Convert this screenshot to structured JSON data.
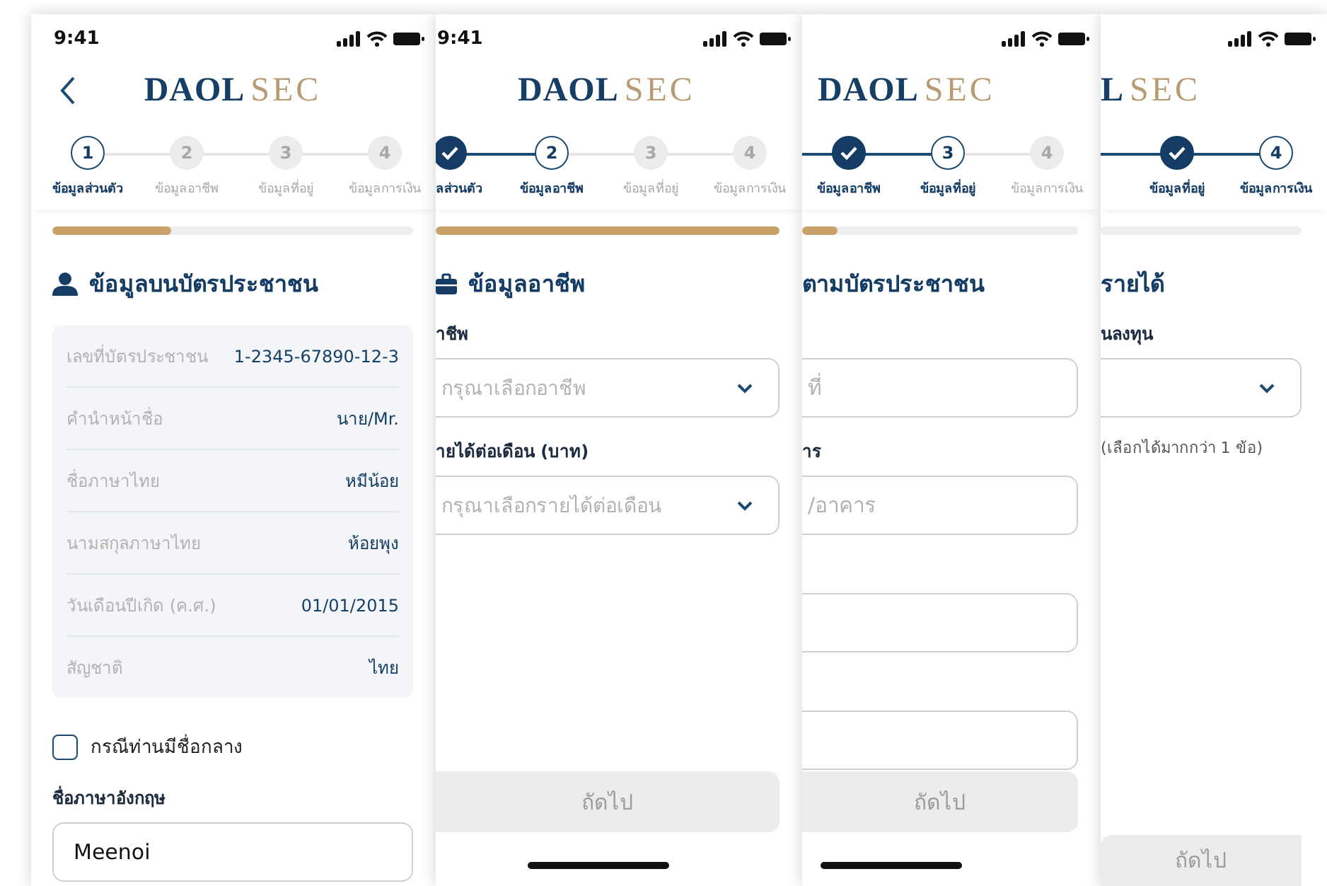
{
  "screens": [
    {
      "status_time": "9:41",
      "back": true,
      "logo": {
        "primary": "DAOL",
        "secondary": "SEC"
      },
      "steps": [
        {
          "number": "1",
          "label": "ข้อมูลส่วนตัว",
          "done": false,
          "selected": true
        },
        {
          "number": "2",
          "label": "ข้อมูลอาชีพ",
          "done": false,
          "selected": false
        },
        {
          "number": "3",
          "label": "ข้อมูลที่อยู่",
          "done": false,
          "selected": false
        },
        {
          "number": "4",
          "label": "ข้อมูลการเงิน",
          "done": false,
          "selected": false
        }
      ],
      "progress": {
        "level": 0.33
      },
      "heading": {
        "text": "ข้อมูลบนบัตรประชาชน"
      },
      "blocks": [
        {
          "kind": "info_card",
          "rows": [
            {
              "label": "เลขที่บัตรประชาชน",
              "value": "1-2345-67890-12-3"
            },
            {
              "label": "คำนำหน้าชื่อ",
              "value": "นาย/Mr."
            },
            {
              "label": "ชื่อภาษาไทย",
              "value": "หมีน้อย"
            },
            {
              "label": "นามสกุลภาษาไทย",
              "value": "ห้อยพุง"
            },
            {
              "label": "วันเดือนปีเกิด (ค.ศ.)",
              "value": "01/01/2015"
            },
            {
              "label": "สัญชาติ",
              "value": "ไทย"
            }
          ]
        },
        {
          "kind": "checkbox",
          "label": "กรณีท่านมีชื่อกลาง",
          "checked": false
        },
        {
          "kind": "input",
          "label": "ชื่อภาษาอังกฤษ",
          "value": "Meenoi"
        }
      ]
    },
    {
      "status_time": "9:41",
      "logo": {
        "primary": "DAOL",
        "secondary": "SEC"
      },
      "steps": [
        {
          "label": "ลส่วนตัว",
          "done": true,
          "selected": false
        },
        {
          "number": "2",
          "label": "ข้อมูลอาชีพ",
          "done": false,
          "selected": true
        },
        {
          "number": "3",
          "label": "ข้อมูลที่อยู่",
          "done": false,
          "selected": false
        },
        {
          "number": "4",
          "label": "ข้อมูลการเงิน",
          "done": false,
          "selected": false
        }
      ],
      "progress": {
        "level": 1
      },
      "heading": {
        "text": "ข้อมูลอาชีพ"
      },
      "blocks": [
        {
          "kind": "select",
          "label": "าชีพ",
          "placeholder": "กรุณาเลือกอาชีพ"
        },
        {
          "kind": "select",
          "label": "ายได้ต่อเดือน (บาท)",
          "placeholder": "กรุณาเลือกรายได้ต่อเดือน"
        }
      ],
      "button": {
        "label": "ถัดไป",
        "disabled": true
      },
      "home_indicator": true
    },
    {
      "logo": {
        "primary": "DAOL",
        "secondary": "SEC"
      },
      "steps": [
        {
          "label": "ข้อมูลอาชีพ",
          "done": true,
          "selected": false
        },
        {
          "number": "3",
          "label": "ข้อมูลที่อยู่",
          "done": false,
          "selected": true
        },
        {
          "number": "4",
          "label": "ข้อมูลการเงิน",
          "done": false,
          "selected": false
        }
      ],
      "progress": {
        "level": 0.13
      },
      "heading": {
        "text": "ตามบัตรประชาชน"
      },
      "blocks": [
        {
          "kind": "input",
          "placeholder": "ที่"
        },
        {
          "kind": "input",
          "label": "าร",
          "placeholder": "/อาคาร"
        },
        {
          "kind": "input"
        },
        {
          "kind": "input"
        }
      ],
      "button": {
        "label": "ถัดไป",
        "disabled": true
      },
      "home_indicator": true
    },
    {
      "logo": {
        "primary": "L",
        "secondary": "SEC"
      },
      "steps": [
        {
          "label": "ข้อมูลที่อยู่",
          "done": true,
          "selected": false
        },
        {
          "number": "4",
          "label": "ข้อมูลการเงิน",
          "done": false,
          "selected": true
        }
      ],
      "progress": {
        "level": 0
      },
      "heading": {
        "text": "รายได้"
      },
      "blocks": [
        {
          "kind": "select",
          "label": "นลงทุน"
        },
        {
          "kind": "note",
          "text": "(เลือกได้มากกว่า 1 ข้อ)"
        }
      ],
      "button": {
        "label": "ถัดไป",
        "disabled": true
      }
    }
  ]
}
